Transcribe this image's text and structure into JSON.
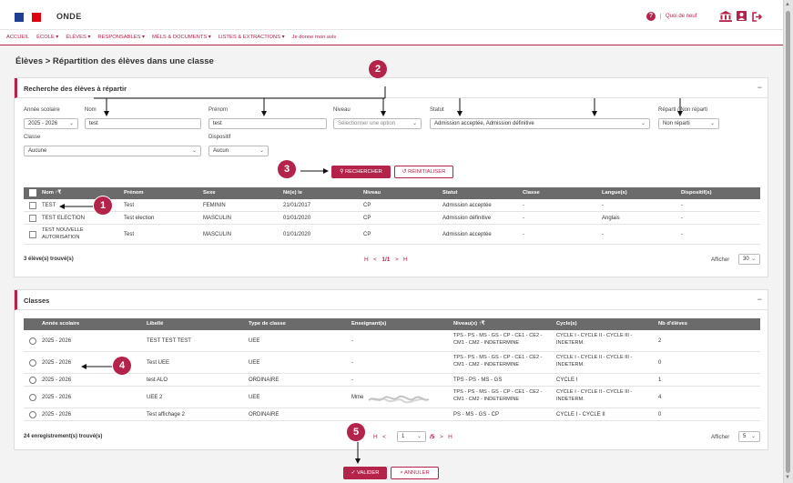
{
  "header": {
    "app_name": "ONDE",
    "help_label": "?",
    "whatsnew_label": "Quoi de neuf",
    "icons": [
      "help-icon",
      "institution-icon",
      "user-icon",
      "logout-icon"
    ],
    "flag_colors": [
      "#1f3f93",
      "#ffffff",
      "#e1000f"
    ]
  },
  "nav": {
    "items": [
      "ACCUEIL",
      "ÉCOLE ▾",
      "ÉLÈVES ▾",
      "RESPONSABLES ▾",
      "MÉLS & DOCUMENTS ▾",
      "LISTES & EXTRACTIONS ▾",
      "Je donne mon avis"
    ]
  },
  "page_title": "Élèves > Répartition des élèves dans une classe",
  "search": {
    "title": "Recherche des élèves à répartir",
    "collapse": "−",
    "fields": {
      "annee": {
        "label": "Année scolaire",
        "value": "2025 - 2026"
      },
      "nom": {
        "label": "Nom",
        "value": "test"
      },
      "prenom": {
        "label": "Prénom",
        "value": "test"
      },
      "niveau": {
        "label": "Niveau",
        "placeholder": "Sélectionner une option"
      },
      "statut": {
        "label": "Statut",
        "value": "Admission acceptée, Admission définitive"
      },
      "reparti": {
        "label": "Réparti / Non réparti",
        "value": "Non réparti"
      },
      "classe": {
        "label": "Classe",
        "value": "Aucune"
      },
      "dispositif": {
        "label": "Dispositif",
        "value": "Aucun"
      }
    },
    "search_button": "RECHERCHER",
    "reset_button": "RÉINITIALISER"
  },
  "students": {
    "columns": [
      "Nom",
      "Prénom",
      "Sexe",
      "Né(e) le",
      "Niveau",
      "Statut",
      "Classe",
      "Langue(s)",
      "Dispositif(s)"
    ],
    "rows": [
      {
        "nom": "TEST",
        "prenom": "Test",
        "sexe": "FEMININ",
        "naissance": "21/01/2017",
        "niveau": "CP",
        "statut": "Admission acceptée",
        "classe": "-",
        "langue": "-",
        "dispositif": "-"
      },
      {
        "nom": "TEST ELECTION",
        "prenom": "Test election",
        "sexe": "MASCULIN",
        "naissance": "01/01/2020",
        "niveau": "CP",
        "statut": "Admission définitive",
        "classe": "-",
        "langue": "Anglais",
        "dispositif": "-"
      },
      {
        "nom": "TEST NOUVELLE AUTORISATION",
        "prenom": "Test",
        "sexe": "MASCULIN",
        "naissance": "01/01/2020",
        "niveau": "CP",
        "statut": "Admission acceptée",
        "classe": "-",
        "langue": "-",
        "dispositif": "-"
      }
    ],
    "count": "3 élève(s) trouvé(s)",
    "pager": {
      "first": "H",
      "prev": "<",
      "page": "1/1",
      "next": ">",
      "last": "H"
    },
    "show_label": "Afficher",
    "show_value": "30"
  },
  "classes": {
    "title": "Classes",
    "collapse": "−",
    "columns": [
      "Année scolaire",
      "Libellé",
      "Type de classe",
      "Enseignant(s)",
      "Niveau(x)",
      "Cycle(s)",
      "Nb d'élèves"
    ],
    "rows": [
      {
        "annee": "2025 - 2026",
        "libelle": "TEST TEST TEST",
        "type": "UEE",
        "enseignant": "-",
        "niveaux": "TPS - PS - MS - GS - CP - CE1 - CE2 - CM1 - CM2 - INDETERMINE",
        "cycles": "CYCLE I - CYCLE II - CYCLE III - INDETERM.",
        "nb": "2"
      },
      {
        "annee": "2025 - 2026",
        "libelle": "Test UEE",
        "type": "UEE",
        "enseignant": "-",
        "niveaux": "TPS - PS - MS - GS - CP - CE1 - CE2 - CM1 - CM2 - INDETERMINE",
        "cycles": "CYCLE I - CYCLE II - CYCLE III - INDETERM.",
        "nb": "0"
      },
      {
        "annee": "2025 - 2026",
        "libelle": "test ALO",
        "type": "ORDINAIRE",
        "enseignant": "-",
        "niveaux": "TPS - PS - MS - GS",
        "cycles": "CYCLE I",
        "nb": "1"
      },
      {
        "annee": "2025 - 2026",
        "libelle": "UEE 2",
        "type": "UEE",
        "enseignant": "Mme",
        "niveaux": "TPS - PS - MS - GS - CP - CE1 - CE2 - CM1 - CM2 - INDETERMINE",
        "cycles": "CYCLE I - CYCLE II - CYCLE III - INDETERM.",
        "nb": "4"
      },
      {
        "annee": "2025 - 2026",
        "libelle": "Test affichage 2",
        "type": "ORDINAIRE",
        "enseignant": "",
        "niveaux": "PS - MS - GS - CP",
        "cycles": "CYCLE I - CYCLE II",
        "nb": "0"
      }
    ],
    "count": "24 enregistrement(s) trouvé(s)",
    "pager": {
      "first": "H",
      "prev": "<",
      "page_value": "1",
      "total": "/5",
      "next": ">",
      "last": "H"
    },
    "show_label": "Afficher",
    "show_value": "5"
  },
  "footer": {
    "validate_button": "VALIDER",
    "cancel_button": "ANNULER"
  },
  "annotations": {
    "markers": [
      "1",
      "2",
      "3",
      "4",
      "5"
    ],
    "color": "#b4234a"
  }
}
